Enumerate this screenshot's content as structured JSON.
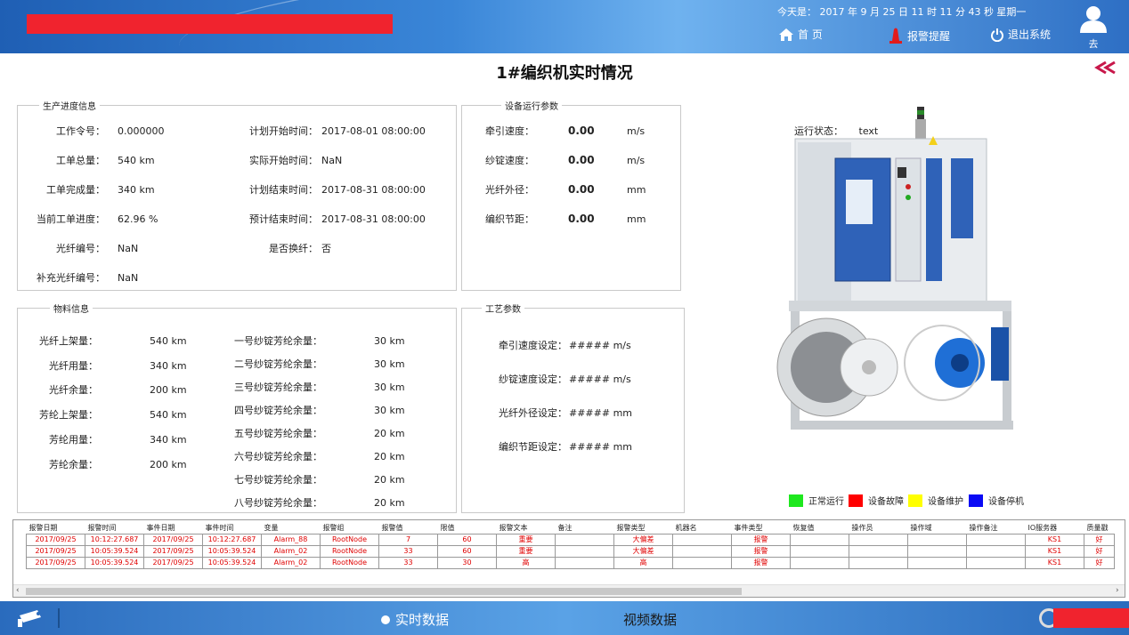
{
  "header": {
    "datetime": "今天是： 2017 年 9 月 25 日  11 时 11 分 43 秒    星期一",
    "home_label": "首 页",
    "alarm_label": "报警提醒",
    "logout_label": "退出系统",
    "user_name": "去"
  },
  "page_title": "1#编织机实时情况",
  "production": {
    "title": "生产进度信息",
    "left": [
      {
        "key": "工作令号：",
        "val": "0.000000"
      },
      {
        "key": "工单总量：",
        "val": "540  km"
      },
      {
        "key": "工单完成量：",
        "val": "340  km"
      },
      {
        "key": "当前工单进度：",
        "val": "62.96  %"
      },
      {
        "key": "光纤编号：",
        "val": "NaN"
      },
      {
        "key": "补充光纤编号：",
        "val": "NaN"
      }
    ],
    "right": [
      {
        "key": "计划开始时间：",
        "val": "2017-08-01  08:00:00"
      },
      {
        "key": "实际开始时间：",
        "val": "NaN"
      },
      {
        "key": "计划结束时间：",
        "val": "2017-08-31  08:00:00"
      },
      {
        "key": "预计结束时间：",
        "val": "2017-08-31  08:00:00"
      },
      {
        "key": "是否换纤：",
        "val": "否"
      }
    ]
  },
  "device": {
    "title": "设备运行参数",
    "rows": [
      {
        "key": "牵引速度：",
        "val": "0.00",
        "unit": "m/s"
      },
      {
        "key": "纱锭速度：",
        "val": "0.00",
        "unit": "m/s"
      },
      {
        "key": "光纤外径：",
        "val": "0.00",
        "unit": "mm"
      },
      {
        "key": "编织节距：",
        "val": "0.00",
        "unit": "mm"
      }
    ]
  },
  "material": {
    "title": "物料信息",
    "left": [
      {
        "key": "光纤上架量：",
        "val": "540  km"
      },
      {
        "key": "光纤用量：",
        "val": "340  km"
      },
      {
        "key": "光纤余量：",
        "val": "200  km"
      },
      {
        "key": "芳纶上架量：",
        "val": "540  km"
      },
      {
        "key": "芳纶用量：",
        "val": "340  km"
      },
      {
        "key": "芳纶余量：",
        "val": "200  km"
      }
    ],
    "right": [
      {
        "key": "一号纱锭芳纶余量：",
        "val": "30  km"
      },
      {
        "key": "二号纱锭芳纶余量：",
        "val": "30  km"
      },
      {
        "key": "三号纱锭芳纶余量：",
        "val": "30  km"
      },
      {
        "key": "四号纱锭芳纶余量：",
        "val": "30  km"
      },
      {
        "key": "五号纱锭芳纶余量：",
        "val": "20  km"
      },
      {
        "key": "六号纱锭芳纶余量：",
        "val": "20  km"
      },
      {
        "key": "七号纱锭芳纶余量：",
        "val": "20  km"
      },
      {
        "key": "八号纱锭芳纶余量：",
        "val": "20  km"
      }
    ]
  },
  "process": {
    "title": "工艺参数",
    "rows": [
      {
        "key": "牵引速度设定：",
        "val": "#####  m/s"
      },
      {
        "key": "纱锭速度设定：",
        "val": "#####  m/s"
      },
      {
        "key": "光纤外径设定：",
        "val": "#####  mm"
      },
      {
        "key": "编织节距设定：",
        "val": "#####  mm"
      }
    ]
  },
  "machine": {
    "status_label": "运行状态：",
    "status_value": "text"
  },
  "legend": [
    {
      "label": "正常运行",
      "color": "#1ee81e"
    },
    {
      "label": "设备故障",
      "color": "#ff0000"
    },
    {
      "label": "设备维护",
      "color": "#ffff00"
    },
    {
      "label": "设备停机",
      "color": "#0a0af5"
    }
  ],
  "alarm_table": {
    "headers": [
      "报警日期",
      "报警时间",
      "事件日期",
      "事件时间",
      "变量",
      "报警组",
      "报警值",
      "限值",
      "报警文本",
      "备注",
      "报警类型",
      "机器名",
      "事件类型",
      "恢复值",
      "操作员",
      "操作域",
      "操作备注",
      "IO服务器",
      "质量戳"
    ],
    "rows": [
      [
        "2017/09/25",
        "10:12:27.687",
        "2017/09/25",
        "10:12:27.687",
        "Alarm_88",
        "RootNode",
        "7",
        "60",
        "重要",
        "",
        "大偏差",
        "",
        "报警",
        "",
        "",
        "",
        "",
        "KS1",
        "好"
      ],
      [
        "2017/09/25",
        "10:05:39.524",
        "2017/09/25",
        "10:05:39.524",
        "Alarm_02",
        "RootNode",
        "33",
        "60",
        "重要",
        "",
        "大偏差",
        "",
        "报警",
        "",
        "",
        "",
        "",
        "KS1",
        "好"
      ],
      [
        "2017/09/25",
        "10:05:39.524",
        "2017/09/25",
        "10:05:39.524",
        "Alarm_02",
        "RootNode",
        "33",
        "30",
        "高",
        "",
        "高",
        "",
        "报警",
        "",
        "",
        "",
        "",
        "KS1",
        "好"
      ]
    ]
  },
  "footer": {
    "tab_realtime": "实时数据",
    "tab_video": "视频数据"
  }
}
